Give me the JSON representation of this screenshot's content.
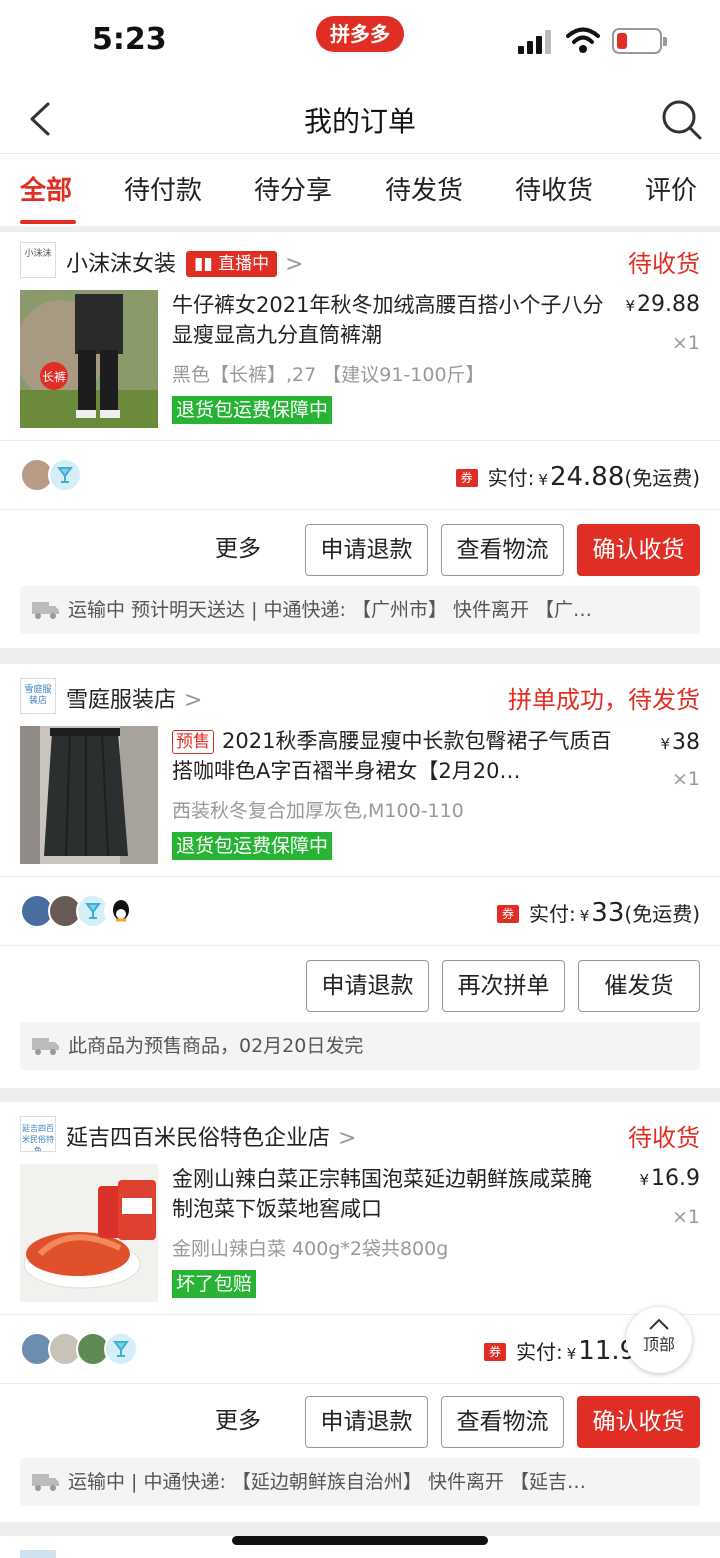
{
  "status_bar": {
    "time": "5:23",
    "app_badge": "拼多多"
  },
  "nav": {
    "title": "我的订单"
  },
  "tabs": [
    "全部",
    "待付款",
    "待分享",
    "待发货",
    "待收货",
    "评价"
  ],
  "orders": [
    {
      "shop_logo": "小沫沫",
      "shop_name": "小沫沫女装",
      "live_badge": "直播中",
      "status": "待收货",
      "product_title": "牛仔裤女2021年秋冬加绒高腰百搭小个子八分显瘦显高九分直筒裤潮",
      "price_symbol": "¥",
      "price": "29.88",
      "qty": "×1",
      "spec": "黑色【长裤】,27 【建议91-100斤】",
      "thumb_tag": "长裤",
      "guarantee": "退货包运费保障中",
      "coupon": "券",
      "paid_label": "实付:",
      "paid_symbol": "¥",
      "paid_amount": "24.88",
      "shipping_note": "(免运费)",
      "buttons": {
        "more": "更多",
        "refund": "申请退款",
        "logistics": "查看物流",
        "confirm": "确认收货"
      },
      "tracking": "运输中 预计明天送达 | 中通快递: 【广州市】 快件离开 【广…"
    },
    {
      "shop_logo": "雪庭服装店",
      "shop_name": "雪庭服装店",
      "status": "拼单成功，待发货",
      "presale_tag": "预售",
      "product_title": "2021秋季高腰显瘦中长款包臀裙子气质百搭咖啡色A字百褶半身裙女【2月20…",
      "price_symbol": "¥",
      "price": "38",
      "qty": "×1",
      "spec": "西装秋冬复合加厚灰色,M100-110",
      "guarantee": "退货包运费保障中",
      "coupon": "券",
      "paid_label": "实付:",
      "paid_symbol": "¥",
      "paid_amount": "33",
      "shipping_note": "(免运费)",
      "buttons": {
        "refund": "申请退款",
        "regroup": "再次拼单",
        "urge": "催发货"
      },
      "tracking": "此商品为预售商品，02月20日发完"
    },
    {
      "shop_logo": "延吉四百米民俗特色",
      "shop_name": "延吉四百米民俗特色企业店",
      "status": "待收货",
      "product_title": "金刚山辣白菜正宗韩国泡菜延边朝鲜族咸菜腌制泡菜下饭菜地窖咸口",
      "price_symbol": "¥",
      "price": "16.9",
      "qty": "×1",
      "spec": "金刚山辣白菜 400g*2袋共800g",
      "guarantee": "坏了包赔",
      "coupon": "券",
      "paid_label": "实付:",
      "paid_symbol": "¥",
      "paid_amount": "11.9",
      "shipping_note": "(免",
      "buttons": {
        "more": "更多",
        "refund": "申请退款",
        "logistics": "查看物流",
        "confirm": "确认收货"
      },
      "tracking": "运输中 | 中通快递: 【延边朝鲜族自治州】 快件离开 【延吉…"
    }
  ],
  "float_top": {
    "label": "顶部"
  },
  "colors": {
    "brand_red": "#e02e24",
    "guarantee_green": "#27b334"
  }
}
